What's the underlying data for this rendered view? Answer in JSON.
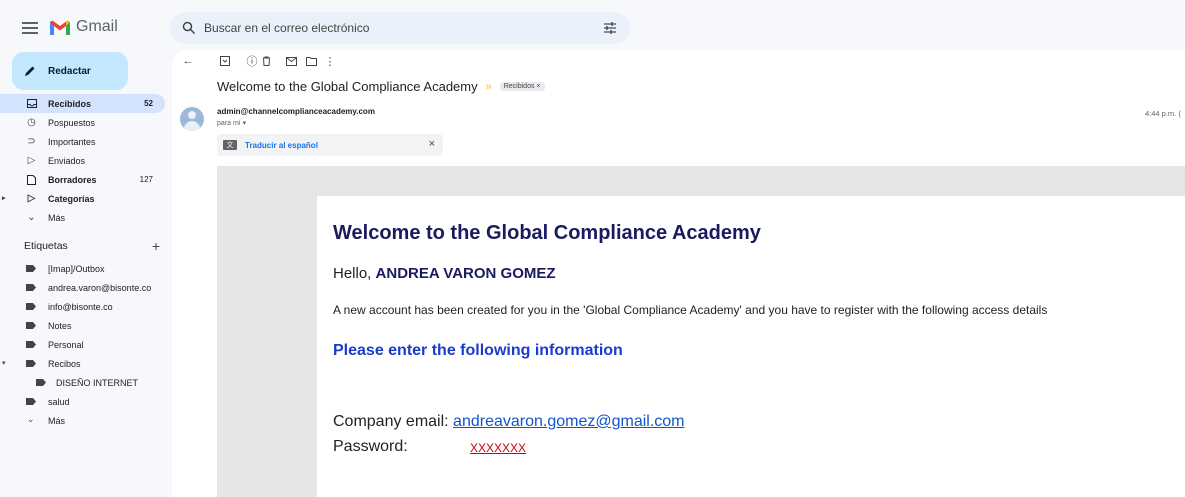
{
  "app": {
    "name": "Gmail"
  },
  "search": {
    "placeholder": "Buscar en el correo electrónico"
  },
  "compose": {
    "label": "Redactar"
  },
  "sidebar": {
    "items": [
      {
        "label": "Recibidos",
        "count": "52"
      },
      {
        "label": "Pospuestos",
        "count": ""
      },
      {
        "label": "Importantes",
        "count": ""
      },
      {
        "label": "Enviados",
        "count": ""
      },
      {
        "label": "Borradores",
        "count": "127"
      },
      {
        "label": "Categorías",
        "count": ""
      },
      {
        "label": "Más",
        "count": ""
      }
    ],
    "labels_heading": "Etiquetas",
    "labels_add": "+",
    "labels": [
      "[Imap]/Outbox",
      "andrea.varon@bisonte.co",
      "info@bisonte.co",
      "Notes",
      "Personal",
      "Recibos",
      "DISEÑO INTERNET",
      "salud",
      "Más"
    ]
  },
  "email": {
    "subject": "Welcome to the Global Compliance Academy",
    "inbox_chip": "Recibidos ×",
    "sender": "admin@channelcomplianceacademy.com",
    "to": "para mí ▾",
    "time": "4:44 p.m. (",
    "translate_label": "Traducir al español",
    "translate_close": "×",
    "body": {
      "heading": "Welcome to the Global Compliance Academy",
      "hello_prefix": "Hello, ",
      "hello_name": "ANDREA VARON GOMEZ",
      "paragraph": "A new account has been created for you in the 'Global Compliance Academy' and you have to register with the following access details",
      "subheading": "Please enter the following information",
      "company_email_label": "Company email: ",
      "company_email": "andreavaron.gomez@gmail.com",
      "password_label": "Password:",
      "password_value": "XXXXXXX"
    }
  },
  "colors": {
    "compose_bg": "#c2e7ff",
    "active_nav": "#d3e3fd",
    "heading": "#1a1a5e",
    "subheading": "#1a3ccc",
    "password": "#d40000"
  }
}
